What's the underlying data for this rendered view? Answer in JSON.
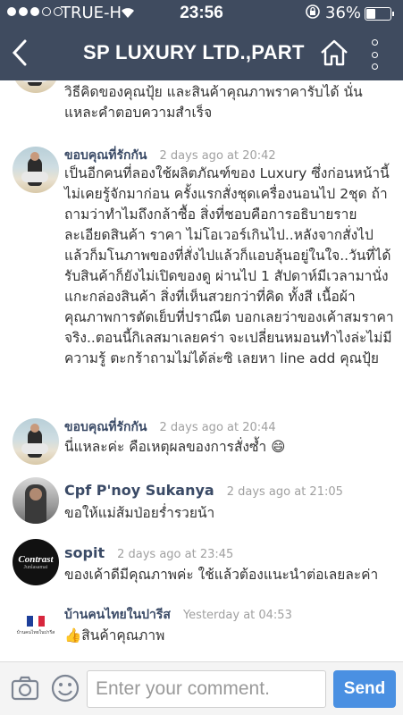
{
  "status_bar": {
    "carrier": "TRUE-H",
    "time": "23:56",
    "battery": "36%",
    "battery_level": 0.36
  },
  "header": {
    "title": "SP LUXURY LTD.,PART"
  },
  "comments": [
    {
      "name": "",
      "time": "",
      "text": "วิธีคิดของคุณปุ้ย และสินค้าคุณภาพราคารับได้ นั่นแหละคำตอบความสำเร็จ"
    },
    {
      "name": "ขอบคุณที่รักกัน",
      "time": "2 days ago at 20:42",
      "text": "เป็นอีกคนที่ลองใช้ผลิตภัณฑ์ของ Luxury ซึ่งก่อนหน้านี้ไม่เคยรู้จักมาก่อน ครั้งแรกสั่งชุดเครื่องนอนไป 2ชุด ถ้าถามว่าทำไมถึงกล้าซื้อ สิ่งที่ชอบคือการอธิบายรายละเอียดสินค้า ราคา ไม่โอเวอร์เกินไป..หลังจากสั่งไปแล้วก็มโนภาพของที่สั่งไปแล้วก็แอบลุ้นอยู่ในใจ..วันที่ได้รับสินค้าก็ยังไม่เปิดของดู ผ่านไป 1 สัปดาห์มีเวลามานั่งแกะกล่องสินค้า สิ่งที่เห็นสวยกว่าที่คิด ทั้งสี เนื้อผ้า คุณภาพการตัดเย็บที่ปราณีต บอกเลยว่าของเค้าสมราคาจริง..ตอนนี้กิเลสมาเลยคร่า จะเปลี่ยนหมอนทำไงล่ะไม่มีความรู้ ตะกร้าถามไม่ได้ล่ะซิ เลยหา line add คุณปุ้ย"
    },
    {
      "name": "ขอบคุณที่รักกัน",
      "time": "2 days ago at 20:44",
      "text": "นี่แหละค่ะ คือเหตุผลของการสั่งซ้ำ 😄"
    },
    {
      "name": "Cpf P'noy Sukanya",
      "time": "2 days ago at 21:05",
      "text": "ขอให้แม่ส้มป่อยรํ่ารวยน้า"
    },
    {
      "name": "sopit",
      "time": "2 days ago at 23:45",
      "text": "ของเค้าดีมีคุณภาพค่ะ ใช้แล้วต้องแนะนำต่อเลยละค่า",
      "avatar_text": "Contrast",
      "avatar_subtext": "Junlasamai"
    },
    {
      "name": "บ้านคนไทยในปารีส",
      "time": "Yesterday at 04:53",
      "text": "👍สินค้าคุณภาพ",
      "avatar_text": "บ้านคนไทยในปารีส"
    }
  ],
  "composer": {
    "placeholder": "Enter your comment.",
    "send_label": "Send"
  },
  "colors": {
    "header_bg": "#3f4b5f",
    "name_color": "#3a4a66",
    "send_bg": "#4a90e2"
  }
}
